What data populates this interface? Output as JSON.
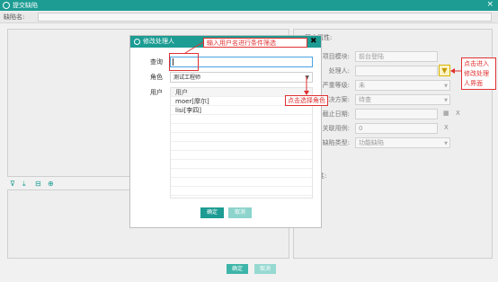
{
  "window": {
    "title": "提交缺陷",
    "close_symbol": "×"
  },
  "defect_name": {
    "label": "缺陷名:",
    "value": ""
  },
  "toolbar_icons": [
    "filter-icon",
    "download-icon",
    "trash-icon",
    "zoom-icon"
  ],
  "right_panel": {
    "title": "基本属性:",
    "rows": [
      {
        "label": "项目模块:",
        "value": "前台登陆"
      },
      {
        "label": "处理人:",
        "value": ""
      },
      {
        "label": "严重等级:",
        "value": "未"
      },
      {
        "label": "解决方案:",
        "value": "待查"
      },
      {
        "label": "截止日期:",
        "value": ""
      },
      {
        "label": "关联用例:",
        "value": "0"
      },
      {
        "label": "缺陷类型:",
        "value": "功能缺陷"
      }
    ],
    "other_title": "其它属性:",
    "x_symbol": "X"
  },
  "main_buttons": {
    "ok": "确定",
    "cancel": "取消"
  },
  "modal": {
    "title": "修改处理人",
    "close_symbol": "✖",
    "query_label": "查询",
    "query_value": "",
    "role_label": "角色",
    "role_value": "测试工程师",
    "user_label": "用户",
    "list_header": "用户",
    "users": [
      "moer[摩尔]",
      "lisi[李四]"
    ],
    "ok": "确定",
    "cancel": "取消"
  },
  "annotations": {
    "query_hint": "输入用户名进行条件筛选",
    "role_hint": "点击选择角色",
    "user_ui_hint": [
      "点击进入",
      "修改处理",
      "人界面"
    ]
  },
  "colors": {
    "accent": "#1c9c93",
    "annotation": "#e03030"
  }
}
